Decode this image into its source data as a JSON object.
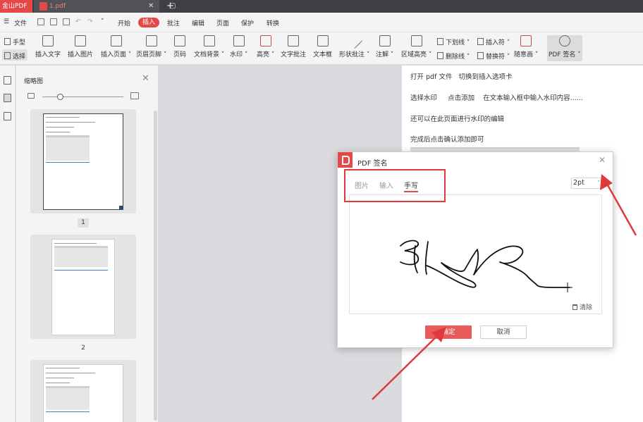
{
  "titlebar": {
    "app_name": "金山PDF",
    "tab_name": "1.pdf",
    "close_glyph": "✕",
    "restore_glyph": "▢",
    "new_tab_glyph": "+"
  },
  "menubar": {
    "file_label": "文件",
    "tabs": [
      "开始",
      "插入",
      "批注",
      "编辑",
      "页面",
      "保护",
      "转换"
    ],
    "active_tab": "插入"
  },
  "ribbon": {
    "hand_label": "手型",
    "select_label": "选择",
    "tools": [
      "插入文字",
      "插入图片",
      "插入页面 ˅",
      "页眉页脚 ˅",
      "页码",
      "文档背景 ˅",
      "水印 ˅",
      "高亮 ˅",
      "文字批注",
      "文本框",
      "形状批注 ˅",
      "注解 ˅",
      "区域高亮 ˅"
    ],
    "small_tools": [
      "下划线 ˅",
      "删除线 ˅",
      "插入符 ˅",
      "替换符 ˅"
    ],
    "freehand_label": "随意画 ˅",
    "sign_label": "PDF 签名 ˅"
  },
  "thumbnails": {
    "title": "缩略图",
    "close_glyph": "✕",
    "pages": [
      "1",
      "2"
    ]
  },
  "document": {
    "lines": [
      "打开 pdf 文件   切换到插入选项卡",
      "选择水印     点击添加    在文本输入框中输入水印内容......",
      "还可以在此页面进行水印的编辑",
      "完成后点击确认添加即可"
    ]
  },
  "dialog": {
    "title": "PDF 签名",
    "close_glyph": "✕",
    "tabs": [
      "图片",
      "输入",
      "手写"
    ],
    "active_tab": "手写",
    "pen_size": "2pt",
    "clear_label": "清除",
    "confirm_label": "确定",
    "cancel_label": "取消"
  },
  "colors": {
    "accent": "#e64747",
    "annotation_red": "#e0393b"
  }
}
